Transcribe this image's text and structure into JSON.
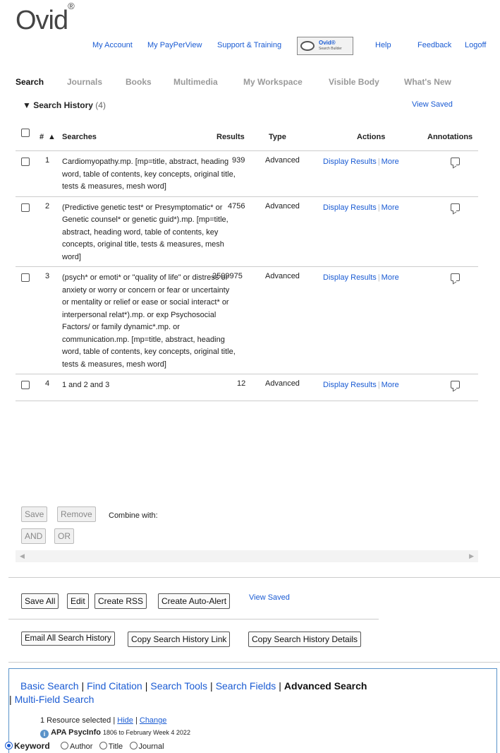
{
  "header": {
    "logo": "Ovid",
    "logo_mark": "®",
    "links": {
      "my_account": "My Account",
      "my_payperview": "My PayPerView",
      "support": "Support & Training",
      "help": "Help",
      "feedback": "Feedback",
      "logoff": "Logoff"
    },
    "search_builder": {
      "brand": "Ovid®",
      "sub": "Search Builder"
    }
  },
  "nav": {
    "search": "Search",
    "journals": "Journals",
    "books": "Books",
    "multimedia": "Multimedia",
    "workspace": "My Workspace",
    "visible_body": "Visible Body",
    "whats_new": "What's New"
  },
  "history": {
    "title": "Search History",
    "count": "(4)",
    "view_saved": "View Saved",
    "columns": {
      "num": "#",
      "sort_icon": "▲",
      "searches": "Searches",
      "results": "Results",
      "type": "Type",
      "actions": "Actions",
      "annotations": "Annotations"
    },
    "rows": [
      {
        "num": "1",
        "search": "Cardiomyopathy.mp. [mp=title, abstract, heading word, table of contents, key concepts, original title, tests & measures, mesh word]",
        "results": "939",
        "type": "Advanced",
        "display": "Display Results",
        "more": "More"
      },
      {
        "num": "2",
        "search": "(Predictive genetic test* or Presymptomatic* or Genetic counsel* or genetic guid*).mp. [mp=title, abstract, heading word, table of contents, key concepts, original title, tests & measures, mesh word]",
        "results": "4756",
        "type": "Advanced",
        "display": "Display Results",
        "more": "More"
      },
      {
        "num": "3",
        "search": "(psych* or emoti* or \"quality of life\" or distress or anxiety or worry or concern or fear or uncertainty or mentality or relief or ease or social interact* or interpersonal relat*).mp. or exp Psychosocial Factors/ or family dynamic*.mp. or communication.mp. [mp=title, abstract, heading word, table of contents, key concepts, original title, tests & measures, mesh word]",
        "results": "2509975",
        "type": "Advanced",
        "display": "Display Results",
        "more": "More"
      },
      {
        "num": "4",
        "search": "1 and 2 and 3",
        "results": "12",
        "type": "Advanced",
        "display": "Display Results",
        "more": "More"
      }
    ],
    "buttons": {
      "save": "Save",
      "remove": "Remove",
      "combine_with": "Combine with:",
      "and": "AND",
      "or": "OR"
    }
  },
  "actions": {
    "save_all": "Save All",
    "edit": "Edit",
    "create_rss": "Create RSS",
    "create_alert": "Create Auto-Alert",
    "view_saved": "View Saved",
    "email_history": "Email All Search History",
    "copy_link": "Copy Search History Link",
    "copy_details": "Copy Search History Details"
  },
  "search_panel": {
    "tabs": {
      "basic": "Basic Search",
      "citation": "Find Citation",
      "tools": "Search Tools",
      "fields": "Search Fields",
      "advanced": "Advanced Search",
      "multi": "Multi-Field Search"
    },
    "resources": {
      "text": "1 Resource selected |",
      "hide": "Hide",
      "change": "Change"
    },
    "database": {
      "name": "APA PsycInfo",
      "range": "1806 to February Week 4 2022"
    },
    "radios": {
      "keyword": "Keyword",
      "author": "Author",
      "title": "Title",
      "journal": "Journal"
    }
  }
}
